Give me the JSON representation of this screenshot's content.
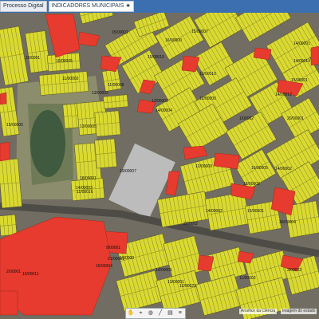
{
  "tabs": [
    {
      "label": "Processo Digital",
      "active": false
    },
    {
      "label": "INDICADORES MUNICIPAIS",
      "active": true,
      "icon": "star-icon"
    }
  ],
  "lot_labels": [
    "15/00001",
    "16/00000",
    "15/00007",
    "14/00001",
    "2/00001",
    "10/00005",
    "15/00010",
    "14/00014",
    "11/00002",
    "11/00008",
    "10/00010",
    "15/00001",
    "14/00012",
    "13/00002",
    "13/00003",
    "12/00000",
    "1/00002",
    "14/00004",
    "13/00005",
    "15/00006",
    "12/00009",
    "16/00005",
    "19/00007",
    "18/00002",
    "14/00003",
    "14/00002",
    "15/00001",
    "30/00004",
    "9/00001",
    "1/00000",
    "14/00001",
    "12/00023",
    "2/00002",
    "16/00004",
    "10/00011",
    "13/00001",
    "2/00002",
    "14/00002",
    "18/00001",
    "11/00003",
    "20/00001",
    "11/00016",
    "2/00001",
    "21/00001"
  ],
  "toolbar": {
    "tools": [
      "hand-icon",
      "location-icon",
      "globe-icon",
      "ruler-icon",
      "chart-icon",
      "layers-icon"
    ]
  },
  "attribution": {
    "left": "Arcéfice da Ciência",
    "right": "Imagem do estado"
  },
  "colors": {
    "parcel_yellow": "#d9d931",
    "parcel_red": "#e63b2e",
    "road": "#6b6860",
    "lake": "#3f5a3e",
    "topbar": "#3c6fb0"
  }
}
